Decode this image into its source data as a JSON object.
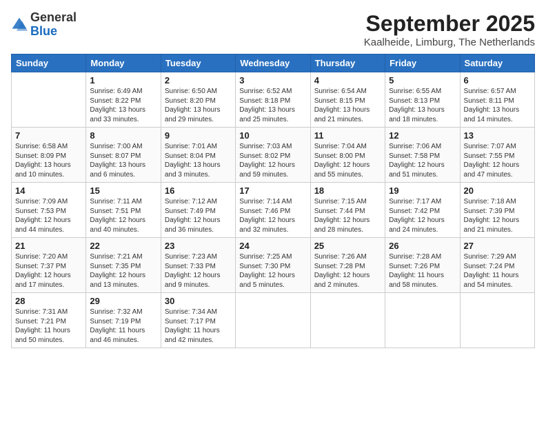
{
  "header": {
    "logo_general": "General",
    "logo_blue": "Blue",
    "month_title": "September 2025",
    "location": "Kaalheide, Limburg, The Netherlands"
  },
  "weekdays": [
    "Sunday",
    "Monday",
    "Tuesday",
    "Wednesday",
    "Thursday",
    "Friday",
    "Saturday"
  ],
  "weeks": [
    [
      {
        "day": "",
        "sunrise": "",
        "sunset": "",
        "daylight": ""
      },
      {
        "day": "1",
        "sunrise": "Sunrise: 6:49 AM",
        "sunset": "Sunset: 8:22 PM",
        "daylight": "Daylight: 13 hours and 33 minutes."
      },
      {
        "day": "2",
        "sunrise": "Sunrise: 6:50 AM",
        "sunset": "Sunset: 8:20 PM",
        "daylight": "Daylight: 13 hours and 29 minutes."
      },
      {
        "day": "3",
        "sunrise": "Sunrise: 6:52 AM",
        "sunset": "Sunset: 8:18 PM",
        "daylight": "Daylight: 13 hours and 25 minutes."
      },
      {
        "day": "4",
        "sunrise": "Sunrise: 6:54 AM",
        "sunset": "Sunset: 8:15 PM",
        "daylight": "Daylight: 13 hours and 21 minutes."
      },
      {
        "day": "5",
        "sunrise": "Sunrise: 6:55 AM",
        "sunset": "Sunset: 8:13 PM",
        "daylight": "Daylight: 13 hours and 18 minutes."
      },
      {
        "day": "6",
        "sunrise": "Sunrise: 6:57 AM",
        "sunset": "Sunset: 8:11 PM",
        "daylight": "Daylight: 13 hours and 14 minutes."
      }
    ],
    [
      {
        "day": "7",
        "sunrise": "Sunrise: 6:58 AM",
        "sunset": "Sunset: 8:09 PM",
        "daylight": "Daylight: 13 hours and 10 minutes."
      },
      {
        "day": "8",
        "sunrise": "Sunrise: 7:00 AM",
        "sunset": "Sunset: 8:07 PM",
        "daylight": "Daylight: 13 hours and 6 minutes."
      },
      {
        "day": "9",
        "sunrise": "Sunrise: 7:01 AM",
        "sunset": "Sunset: 8:04 PM",
        "daylight": "Daylight: 13 hours and 3 minutes."
      },
      {
        "day": "10",
        "sunrise": "Sunrise: 7:03 AM",
        "sunset": "Sunset: 8:02 PM",
        "daylight": "Daylight: 12 hours and 59 minutes."
      },
      {
        "day": "11",
        "sunrise": "Sunrise: 7:04 AM",
        "sunset": "Sunset: 8:00 PM",
        "daylight": "Daylight: 12 hours and 55 minutes."
      },
      {
        "day": "12",
        "sunrise": "Sunrise: 7:06 AM",
        "sunset": "Sunset: 7:58 PM",
        "daylight": "Daylight: 12 hours and 51 minutes."
      },
      {
        "day": "13",
        "sunrise": "Sunrise: 7:07 AM",
        "sunset": "Sunset: 7:55 PM",
        "daylight": "Daylight: 12 hours and 47 minutes."
      }
    ],
    [
      {
        "day": "14",
        "sunrise": "Sunrise: 7:09 AM",
        "sunset": "Sunset: 7:53 PM",
        "daylight": "Daylight: 12 hours and 44 minutes."
      },
      {
        "day": "15",
        "sunrise": "Sunrise: 7:11 AM",
        "sunset": "Sunset: 7:51 PM",
        "daylight": "Daylight: 12 hours and 40 minutes."
      },
      {
        "day": "16",
        "sunrise": "Sunrise: 7:12 AM",
        "sunset": "Sunset: 7:49 PM",
        "daylight": "Daylight: 12 hours and 36 minutes."
      },
      {
        "day": "17",
        "sunrise": "Sunrise: 7:14 AM",
        "sunset": "Sunset: 7:46 PM",
        "daylight": "Daylight: 12 hours and 32 minutes."
      },
      {
        "day": "18",
        "sunrise": "Sunrise: 7:15 AM",
        "sunset": "Sunset: 7:44 PM",
        "daylight": "Daylight: 12 hours and 28 minutes."
      },
      {
        "day": "19",
        "sunrise": "Sunrise: 7:17 AM",
        "sunset": "Sunset: 7:42 PM",
        "daylight": "Daylight: 12 hours and 24 minutes."
      },
      {
        "day": "20",
        "sunrise": "Sunrise: 7:18 AM",
        "sunset": "Sunset: 7:39 PM",
        "daylight": "Daylight: 12 hours and 21 minutes."
      }
    ],
    [
      {
        "day": "21",
        "sunrise": "Sunrise: 7:20 AM",
        "sunset": "Sunset: 7:37 PM",
        "daylight": "Daylight: 12 hours and 17 minutes."
      },
      {
        "day": "22",
        "sunrise": "Sunrise: 7:21 AM",
        "sunset": "Sunset: 7:35 PM",
        "daylight": "Daylight: 12 hours and 13 minutes."
      },
      {
        "day": "23",
        "sunrise": "Sunrise: 7:23 AM",
        "sunset": "Sunset: 7:33 PM",
        "daylight": "Daylight: 12 hours and 9 minutes."
      },
      {
        "day": "24",
        "sunrise": "Sunrise: 7:25 AM",
        "sunset": "Sunset: 7:30 PM",
        "daylight": "Daylight: 12 hours and 5 minutes."
      },
      {
        "day": "25",
        "sunrise": "Sunrise: 7:26 AM",
        "sunset": "Sunset: 7:28 PM",
        "daylight": "Daylight: 12 hours and 2 minutes."
      },
      {
        "day": "26",
        "sunrise": "Sunrise: 7:28 AM",
        "sunset": "Sunset: 7:26 PM",
        "daylight": "Daylight: 11 hours and 58 minutes."
      },
      {
        "day": "27",
        "sunrise": "Sunrise: 7:29 AM",
        "sunset": "Sunset: 7:24 PM",
        "daylight": "Daylight: 11 hours and 54 minutes."
      }
    ],
    [
      {
        "day": "28",
        "sunrise": "Sunrise: 7:31 AM",
        "sunset": "Sunset: 7:21 PM",
        "daylight": "Daylight: 11 hours and 50 minutes."
      },
      {
        "day": "29",
        "sunrise": "Sunrise: 7:32 AM",
        "sunset": "Sunset: 7:19 PM",
        "daylight": "Daylight: 11 hours and 46 minutes."
      },
      {
        "day": "30",
        "sunrise": "Sunrise: 7:34 AM",
        "sunset": "Sunset: 7:17 PM",
        "daylight": "Daylight: 11 hours and 42 minutes."
      },
      {
        "day": "",
        "sunrise": "",
        "sunset": "",
        "daylight": ""
      },
      {
        "day": "",
        "sunrise": "",
        "sunset": "",
        "daylight": ""
      },
      {
        "day": "",
        "sunrise": "",
        "sunset": "",
        "daylight": ""
      },
      {
        "day": "",
        "sunrise": "",
        "sunset": "",
        "daylight": ""
      }
    ]
  ]
}
